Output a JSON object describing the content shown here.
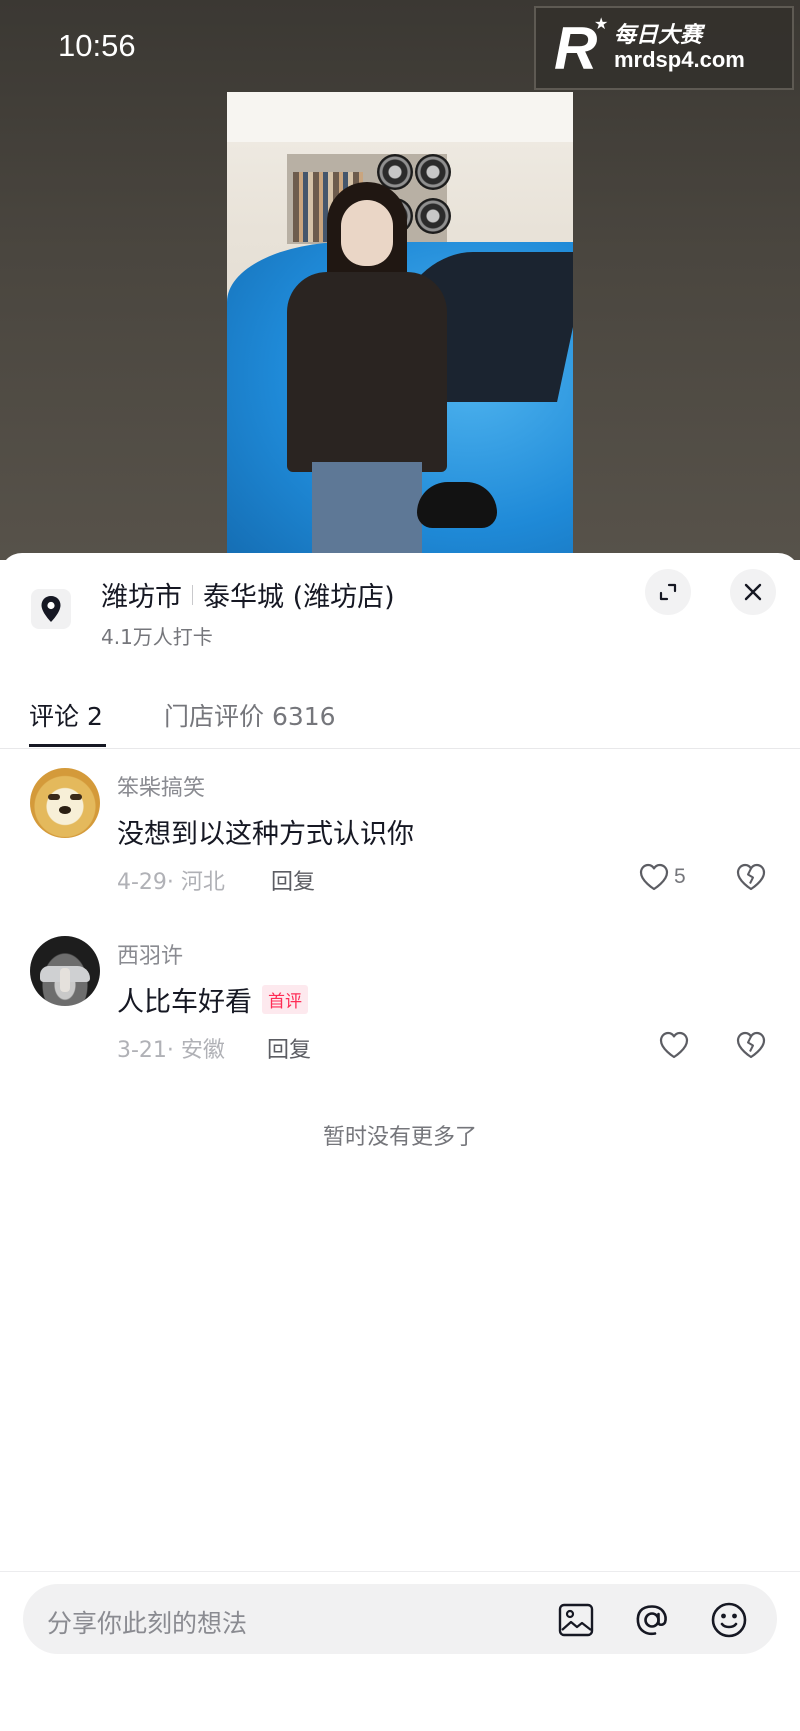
{
  "status_bar": {
    "time": "10:56"
  },
  "watermark": {
    "logo_letter": "R",
    "brand": "每日大赛",
    "url": "mrdsp4.com"
  },
  "location": {
    "city": "潍坊市",
    "place": "泰华城 (潍坊店)",
    "checkins": "4.1万人打卡"
  },
  "tabs": [
    {
      "label": "评论 2",
      "active": true
    },
    {
      "label": "门店评价 6316",
      "active": false
    }
  ],
  "comments": [
    {
      "username": "笨柴搞笑",
      "text": "没想到以这种方式认识你",
      "meta": "4-29· 河北",
      "reply_label": "回复",
      "likes": "5",
      "badge": ""
    },
    {
      "username": "西羽许",
      "text": "人比车好看",
      "meta": "3-21· 安徽",
      "reply_label": "回复",
      "likes": "",
      "badge": "首评"
    }
  ],
  "end_text": "暂时没有更多了",
  "input": {
    "placeholder": "分享你此刻的想法"
  },
  "icons": {
    "location": "location-pin-icon",
    "expand": "expand-icon",
    "close": "close-icon",
    "like": "heart-icon",
    "dislike": "broken-heart-icon",
    "image": "image-icon",
    "mention": "at-icon",
    "emoji": "emoji-icon"
  },
  "colors": {
    "accent": "#fe2c55",
    "text": "#161823",
    "muted": "#75767b"
  }
}
